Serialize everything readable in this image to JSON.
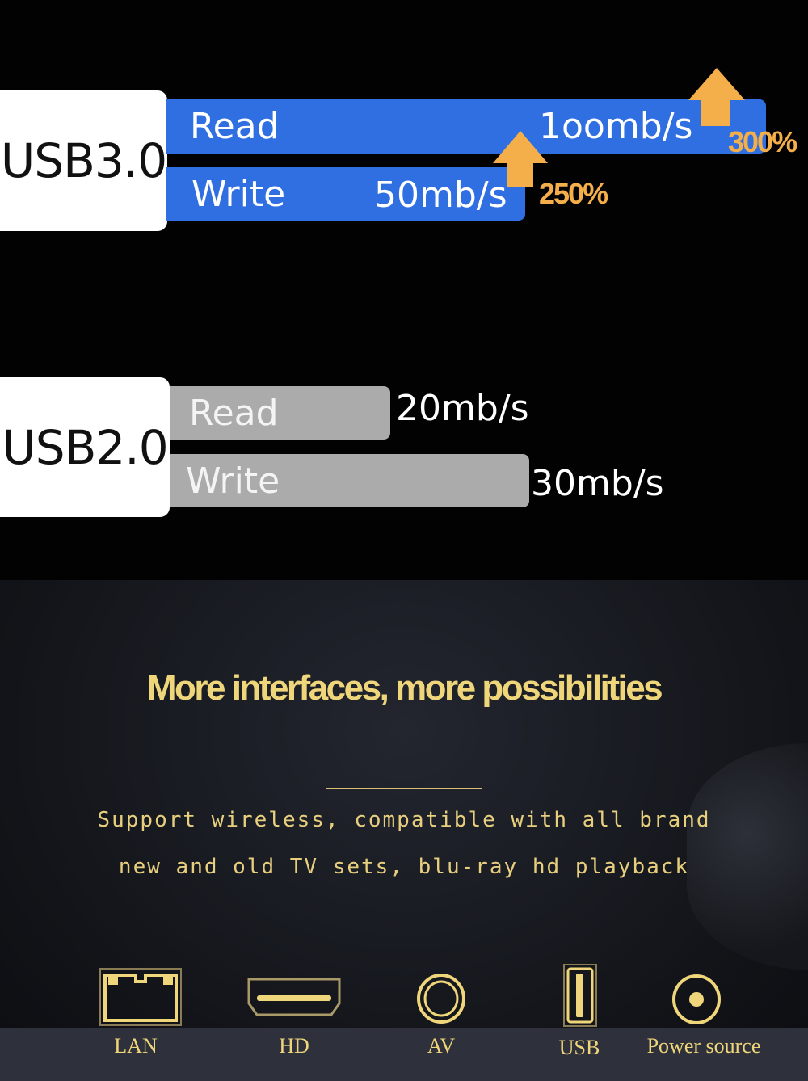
{
  "usb3": {
    "label": "USB3.0",
    "read_label": "Read",
    "read_value": "1oomb/s",
    "read_increase": "300%",
    "write_label": "Write",
    "write_value": "50mb/s",
    "write_increase": "250%"
  },
  "usb2": {
    "label": "USB2.0",
    "read_label": "Read",
    "read_value": "20mb/s",
    "write_label": "Write",
    "write_value": "30mb/s"
  },
  "headline": "More interfaces, more possibilities",
  "description": [
    "Support wireless, compatible with all brand",
    "new and old TV sets, blu-ray hd playback"
  ],
  "ports": [
    {
      "label": "LAN",
      "icon": "lan-port-icon"
    },
    {
      "label": "HD",
      "icon": "hdmi-port-icon"
    },
    {
      "label": "AV",
      "icon": "av-port-icon"
    },
    {
      "label": "USB",
      "icon": "usb-port-icon"
    },
    {
      "label": "Power source",
      "icon": "power-port-icon"
    }
  ],
  "colors": {
    "usb3_bar": "#2f6fe2",
    "usb2_bar": "#ababab",
    "arrow": "#f4ae4a",
    "gold": "#f0d67a"
  }
}
